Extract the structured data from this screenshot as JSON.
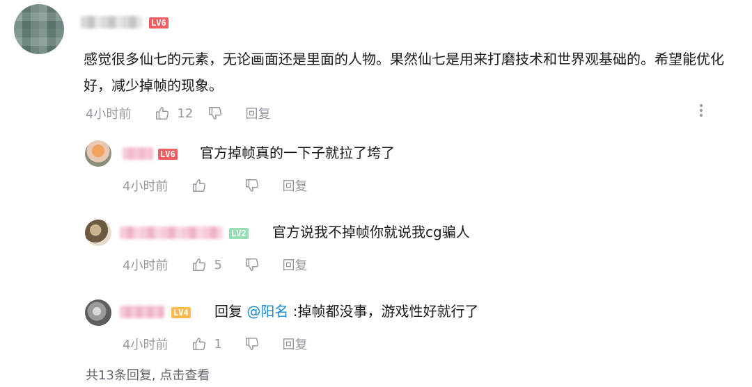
{
  "main_comment": {
    "level_badge": "LV6",
    "level_color": "#f25d62",
    "text": "感觉很多仙七的元素，无论画面还是里面的人物。果然仙七是用来打磨技术和世界观基础的。希望能优化好，减少掉帧的现象。",
    "time": "4小时前",
    "like_icon": "thumbs-up-icon",
    "like_count": "12",
    "dislike_icon": "thumbs-down-icon",
    "reply_label": "回复",
    "more_icon": "more-vertical-icon"
  },
  "replies": [
    {
      "level_badge": "LV6",
      "level_color": "#f25d62",
      "text": "官方掉帧真的一下子就拉了垮了",
      "time": "4小时前",
      "like_count": "",
      "reply_label": "回复"
    },
    {
      "level_badge": "LV2",
      "level_color": "#95ddb2",
      "text": "官方说我不掉帧你就说我cg骗人",
      "time": "4小时前",
      "like_count": "5",
      "reply_label": "回复"
    },
    {
      "level_badge": "LV4",
      "level_color": "#feba51",
      "reply_prefix": "回复",
      "mention": "@阳名",
      "text": ":掉帧都没事，游戏性好就行了",
      "time": "4小时前",
      "like_count": "1",
      "reply_label": "回复"
    }
  ],
  "footer": {
    "view_more": "共13条回复, 点击查看"
  },
  "colors": {
    "text": "#18191c",
    "meta": "#9499a0",
    "mention": "#178bcf"
  }
}
